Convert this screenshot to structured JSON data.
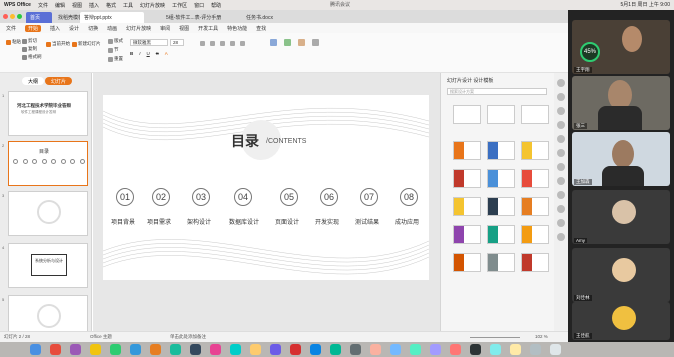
{
  "menubar": {
    "items": [
      "WPS Office",
      "文件",
      "编辑",
      "视图",
      "插入",
      "格式",
      "工具",
      "幻灯片放映",
      "工作区",
      "窗口",
      "帮助"
    ],
    "title": "腾讯会议",
    "right": "5月1日 周日 上午 9:00"
  },
  "tabs": [
    {
      "label": "首页"
    },
    {
      "label": "找稻壳模板"
    },
    {
      "label": "答辩ppt.pptx"
    },
    {
      "label": "5组-软件工...表-评分手册"
    },
    {
      "label": "任务书.docx"
    }
  ],
  "ribbon_tabs": [
    "文件",
    "开始",
    "插入",
    "设计",
    "切换",
    "动画",
    "幻灯片放映",
    "审阅",
    "视图",
    "开发工具",
    "特色功能",
    "查找"
  ],
  "ribbon": {
    "paste": "粘贴",
    "cut": "剪切",
    "copy": "复制",
    "format": "格式刷",
    "from_current": "当前开始",
    "new_slide": "新建幻灯片",
    "layout": "版式",
    "section": "节",
    "reset": "重置",
    "font_placeholder": "微软雅黑",
    "font_size": "28",
    "zoom_label": "缩放"
  },
  "leftpanel": {
    "tab_outline": "大纲",
    "tab_slides": "幻灯片",
    "thumb1_title": "河北工程技术学院毕业答辩",
    "thumb1_sub": "软件工程课程设计答辩",
    "thumb2_title": "目录",
    "thumb4_text": "系统分析与设计"
  },
  "slide": {
    "title": "目录",
    "title_suffix": "/CONTENTS",
    "items": [
      {
        "num": "01",
        "label": "项目背景"
      },
      {
        "num": "02",
        "label": "项目需求"
      },
      {
        "num": "03",
        "label": "架构设计"
      },
      {
        "num": "04",
        "label": "数据库设计"
      },
      {
        "num": "05",
        "label": "页面设计"
      },
      {
        "num": "06",
        "label": "开发实现"
      },
      {
        "num": "07",
        "label": "测试结果"
      },
      {
        "num": "08",
        "label": "成功应用"
      }
    ]
  },
  "rightpanel": {
    "title": "幻灯片设计  设计模板",
    "search": "搜索设计方案"
  },
  "statusbar": {
    "left": "幻灯片 2 / 28",
    "theme": "Office 主题",
    "notes": "单击此处添加备注",
    "zoom": "102 %"
  },
  "zoom": {
    "badge_pct": "45%",
    "participants": [
      {
        "name": "王宇翔"
      },
      {
        "name": "张三"
      },
      {
        "name": "王加森"
      },
      {
        "name": "Amy"
      },
      {
        "name": "刘佳林"
      },
      {
        "name": "王佳航"
      }
    ]
  },
  "colors": {
    "accent": "#e8751a",
    "zoom_green": "#2ecc71"
  }
}
